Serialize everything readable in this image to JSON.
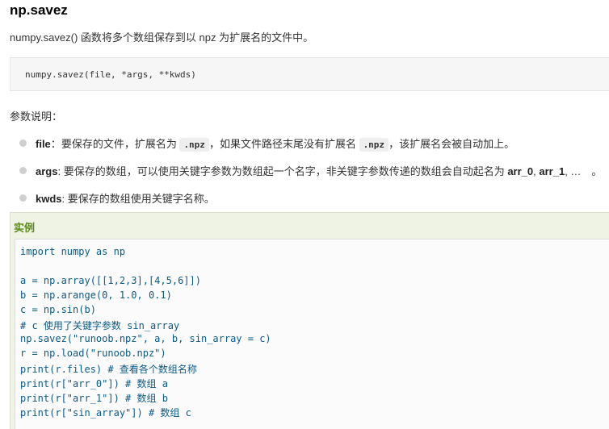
{
  "heading": "np.savez",
  "intro": "numpy.savez() 函数将多个数组保存到以 npz 为扩展名的文件中。",
  "signature": "numpy.savez(file, *args, **kwds)",
  "params_label": "参数说明：",
  "params": [
    {
      "name": "file",
      "sep": "：",
      "t1": "要保存的文件，扩展名为 ",
      "c1": ".npz",
      "t2": "，如果文件路径末尾没有扩展名 ",
      "c2": ".npz",
      "t3": "，该扩展名会被自动加上。"
    },
    {
      "name": "args",
      "sep": ": ",
      "t1": "要保存的数组，可以使用关键字参数为数组起一个名字，非关键字参数传递的数组会自动起名为 ",
      "b1": "arr_0",
      "t2": ", ",
      "b2": "arr_1",
      "t3": ", …　。"
    },
    {
      "name": "kwds",
      "sep": ": ",
      "t1": "要保存的数组使用关键字名称。"
    }
  ],
  "example_title": "实例",
  "code_lines": [
    "import numpy as np",
    "",
    "a = np.array([[1,2,3],[4,5,6]])",
    "b = np.arange(0, 1.0, 0.1)",
    "c = np.sin(b)",
    "# c 使用了关键字参数 sin_array",
    "np.savez(\"runoob.npz\", a, b, sin_array = c)",
    "r = np.load(\"runoob.npz\")",
    "print(r.files) # 查看各个数组名称",
    "print(r[\"arr_0\"]) # 数组 a",
    "print(r[\"arr_1\"]) # 数组 b",
    "print(r[\"sin_array\"]) # 数组 c"
  ]
}
